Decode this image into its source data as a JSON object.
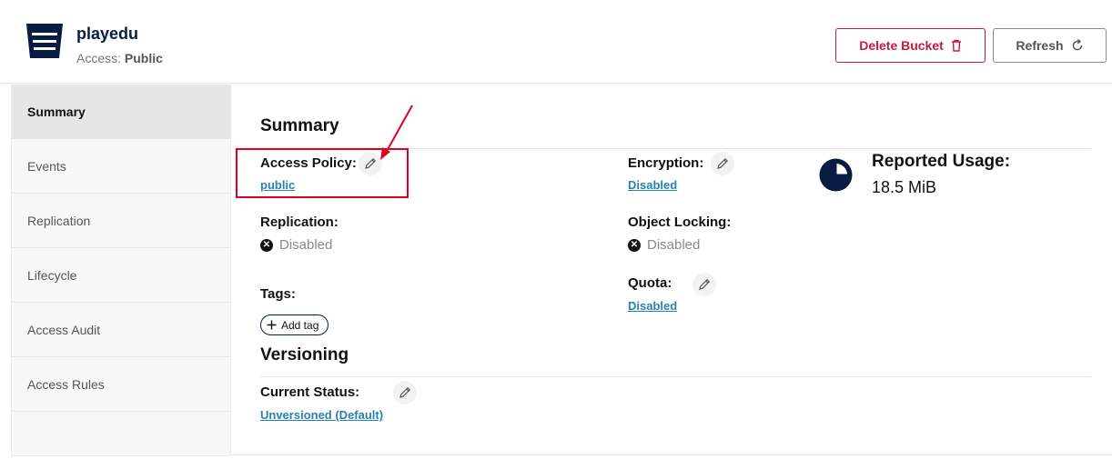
{
  "header": {
    "bucket_name": "playedu",
    "access_label": "Access:",
    "access_value": "Public",
    "delete_button": "Delete Bucket",
    "refresh_button": "Refresh"
  },
  "sidebar": {
    "items": [
      {
        "label": "Summary",
        "active": true
      },
      {
        "label": "Events",
        "active": false
      },
      {
        "label": "Replication",
        "active": false
      },
      {
        "label": "Lifecycle",
        "active": false
      },
      {
        "label": "Access Audit",
        "active": false
      },
      {
        "label": "Access Rules",
        "active": false
      }
    ]
  },
  "summary": {
    "title": "Summary",
    "access_policy_label": "Access Policy:",
    "access_policy_value": "public",
    "encryption_label": "Encryption:",
    "encryption_value": "Disabled",
    "replication_label": "Replication:",
    "replication_value": "Disabled",
    "object_locking_label": "Object Locking:",
    "object_locking_value": "Disabled",
    "tags_label": "Tags:",
    "add_tag_button": "Add tag",
    "quota_label": "Quota:",
    "quota_value": "Disabled",
    "reported_usage_label": "Reported Usage:",
    "reported_usage_value": "18.5 MiB"
  },
  "versioning": {
    "title": "Versioning",
    "current_status_label": "Current Status:",
    "current_status_value": "Unversioned (Default)"
  },
  "colors": {
    "danger": "#c51b3f",
    "link": "#2781b0",
    "navy": "#081c42",
    "annotation": "#e0001b"
  },
  "icons": [
    "bucket-icon",
    "trash-icon",
    "refresh-icon",
    "pencil-icon",
    "x-circle-icon",
    "plus-icon",
    "pie-chart-icon",
    "annotation-arrow"
  ]
}
